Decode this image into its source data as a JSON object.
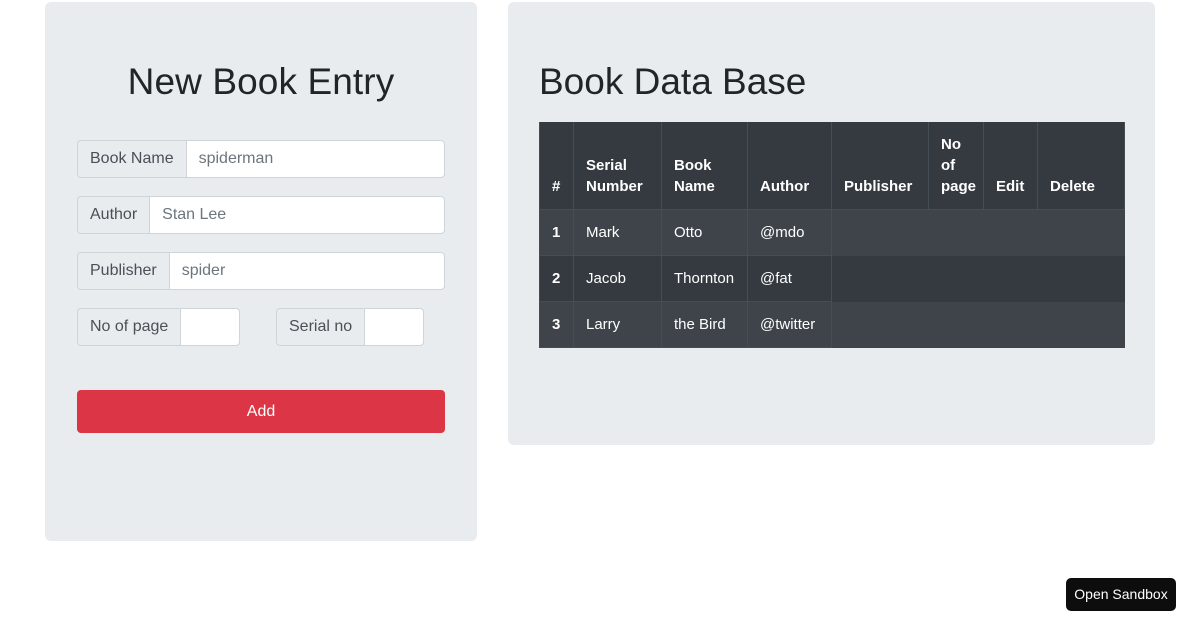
{
  "form": {
    "title": "New Book Entry",
    "fields": [
      {
        "label": "Book Name",
        "value": "",
        "placeholder": "spiderman"
      },
      {
        "label": "Author",
        "value": "",
        "placeholder": "Stan Lee"
      },
      {
        "label": "Publisher",
        "value": "",
        "placeholder": "spider"
      }
    ],
    "small_fields": [
      {
        "label": "No of page",
        "value": "",
        "placeholder": ""
      },
      {
        "label": "Serial no",
        "value": "",
        "placeholder": ""
      }
    ],
    "submit_label": "Add",
    "submit_color": "#dc3545"
  },
  "database": {
    "title": "Book Data Base",
    "columns": [
      "#",
      "Serial Number",
      "Book Name",
      "Author",
      "Publisher",
      "No of page",
      "Edit",
      "Delete"
    ],
    "rows": [
      {
        "index": "1",
        "serial_number": "Mark",
        "book_name": "Otto",
        "author": "@mdo"
      },
      {
        "index": "2",
        "serial_number": "Jacob",
        "book_name": "Thornton",
        "author": "@fat"
      },
      {
        "index": "3",
        "serial_number": "Larry",
        "book_name": "the Bird",
        "author": "@twitter"
      }
    ],
    "header_bg": "#343a40",
    "row_bg": "#3e444a"
  },
  "sandbox": {
    "label": "Open Sandbox"
  }
}
